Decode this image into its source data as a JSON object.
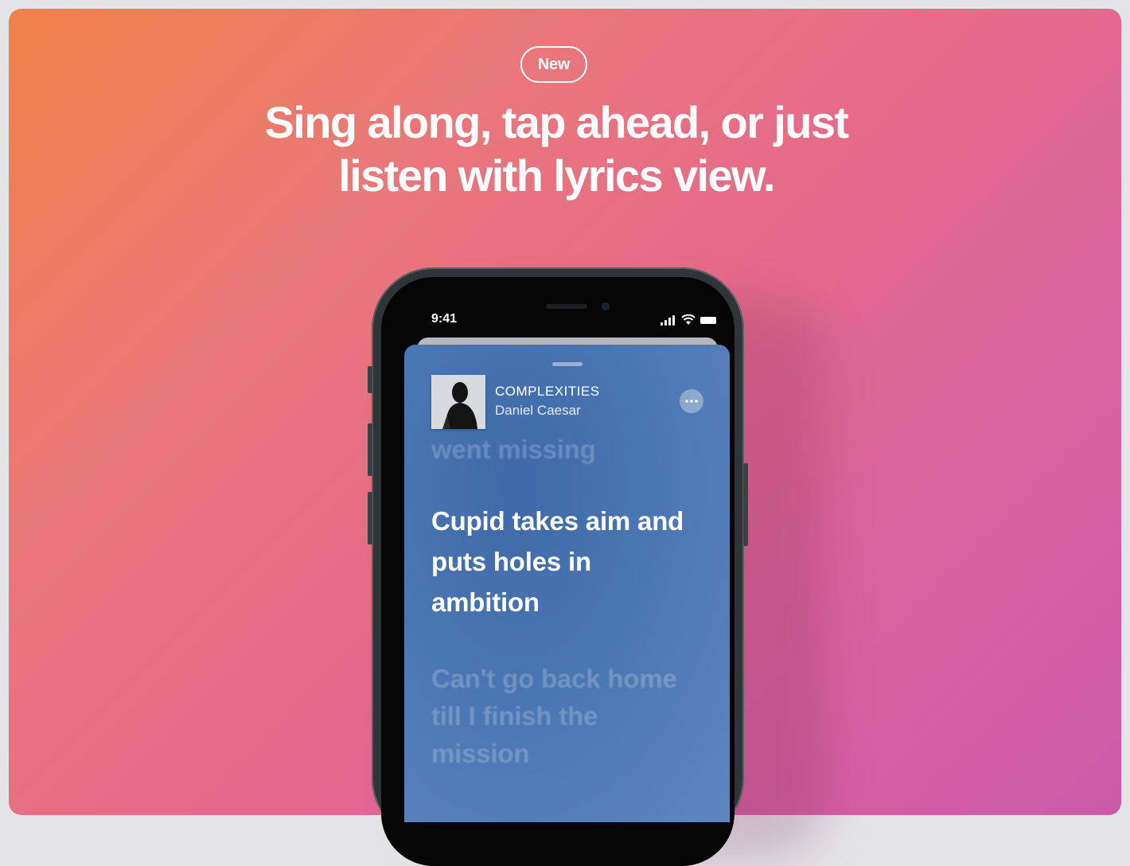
{
  "badge": {
    "label": "New"
  },
  "headline": {
    "line1": "Sing along, tap ahead, or just",
    "line2": "listen with lyrics view."
  },
  "phone": {
    "status_time": "9:41",
    "now_playing": {
      "title": "COMPLEXITIES",
      "artist": "Daniel Caesar"
    },
    "lyrics": {
      "previous": "went missing",
      "current": "Cupid takes aim and puts holes in ambition",
      "next": "Can't go back home till I finish the mission"
    }
  },
  "colors": {
    "gradient_start": "#ee8246",
    "gradient_mid": "#e56b89",
    "gradient_end": "#cb5aa9",
    "lyrics_background": "#4a76b2"
  }
}
